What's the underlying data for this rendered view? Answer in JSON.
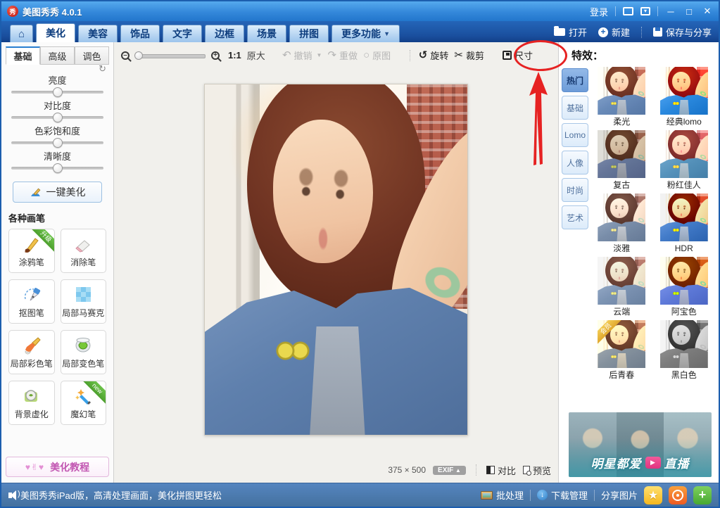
{
  "window": {
    "title": "美图秀秀 4.0.1",
    "login": "登录"
  },
  "nav": {
    "tabs": [
      {
        "label": "美化"
      },
      {
        "label": "美容"
      },
      {
        "label": "饰品"
      },
      {
        "label": "文字"
      },
      {
        "label": "边框"
      },
      {
        "label": "场景"
      },
      {
        "label": "拼图"
      },
      {
        "label": "更多功能"
      }
    ],
    "dropdown_caret": "▼",
    "actions": {
      "open": "打开",
      "new": "新建",
      "save": "保存与分享"
    }
  },
  "toolbar": {
    "zoom_value": 5,
    "actual_ratio": "1:1",
    "actual_label": "原大",
    "undo": "撤销",
    "redo": "重做",
    "original": "原图",
    "rotate": "旋转",
    "crop": "裁剪",
    "resize": "尺寸",
    "rotate_icon": "↺",
    "crop_icon": "✂",
    "undo_icon": "↶",
    "redo_icon": "↷",
    "original_icon": "○"
  },
  "left": {
    "tabs": [
      {
        "label": "基础"
      },
      {
        "label": "高级"
      },
      {
        "label": "调色"
      }
    ],
    "reset_icon": "↻",
    "sliders": [
      {
        "label": "亮度",
        "value": 50
      },
      {
        "label": "对比度",
        "value": 50
      },
      {
        "label": "色彩饱和度",
        "value": 50
      },
      {
        "label": "清晰度",
        "value": 50
      }
    ],
    "one_key": "一键美化",
    "brushes_title": "各种画笔",
    "brushes": [
      {
        "label": "涂鸦笔",
        "badge": "升级"
      },
      {
        "label": "消除笔"
      },
      {
        "label": "抠图笔"
      },
      {
        "label": "局部马赛克"
      },
      {
        "label": "局部彩色笔"
      },
      {
        "label": "局部变色笔"
      },
      {
        "label": "背景虚化"
      },
      {
        "label": "魔幻笔",
        "badge": "new"
      }
    ],
    "tutorial": "美化教程",
    "tutorial_icon": "♥✌♥"
  },
  "canvas": {
    "size_label": "375 × 500",
    "exif": "EXIF",
    "exif_caret": "▲",
    "compare": "对比",
    "preview": "预览"
  },
  "effects": {
    "title": "特效：",
    "tabs": [
      {
        "label": "热门"
      },
      {
        "label": "基础"
      },
      {
        "label": "Lomo"
      },
      {
        "label": "人像"
      },
      {
        "label": "时尚"
      },
      {
        "label": "艺术"
      }
    ],
    "items": [
      {
        "label": "柔光",
        "style": "filter:brightness(1.08) saturate(0.95)"
      },
      {
        "label": "经典lomo",
        "style": "filter:saturate(1.8) contrast(1.25) hue-rotate(-8deg)"
      },
      {
        "label": "复古",
        "style": "filter:saturate(0.75) brightness(0.93) hue-rotate(8deg)"
      },
      {
        "label": "粉红佳人",
        "style": "filter:brightness(1.1) saturate(1.15) hue-rotate(-14deg)"
      },
      {
        "label": "淡雅",
        "style": "filter:saturate(0.55) brightness(1.12)"
      },
      {
        "label": "HDR",
        "style": "filter:contrast(1.45) saturate(1.25) brightness(0.95)"
      },
      {
        "label": "云端",
        "style": "filter:brightness(1.18) saturate(0.65) contrast(0.92)"
      },
      {
        "label": "阿宝色",
        "style": "filter:saturate(1.5) hue-rotate(14deg) contrast(1.15)"
      },
      {
        "label": "后青春",
        "style": "filter:sepia(0.45) saturate(1.2) brightness(1.05)",
        "badge": "会员"
      },
      {
        "label": "黑白色",
        "style": "filter:grayscale(1) contrast(1.05)"
      }
    ],
    "banner": {
      "text1": "明星都爱",
      "play_icon": "▶",
      "text2": "直播"
    }
  },
  "statusbar": {
    "ticker": "美图秀秀iPad版，高清处理画面，美化拼图更轻松",
    "batch": "批处理",
    "download": "下载管理",
    "share": "分享图片",
    "qzone_star": "★",
    "plus_sign": "+",
    "download_arrow": "↓"
  },
  "colors": {
    "annotation_red": "#e62222",
    "titlebar_blue": "#2e7fd6",
    "nav_navy": "#1a4f9e",
    "qzone_yellow": "#f5b71e",
    "weibo_orange": "#ee5a22",
    "plus_green": "#47a832"
  }
}
